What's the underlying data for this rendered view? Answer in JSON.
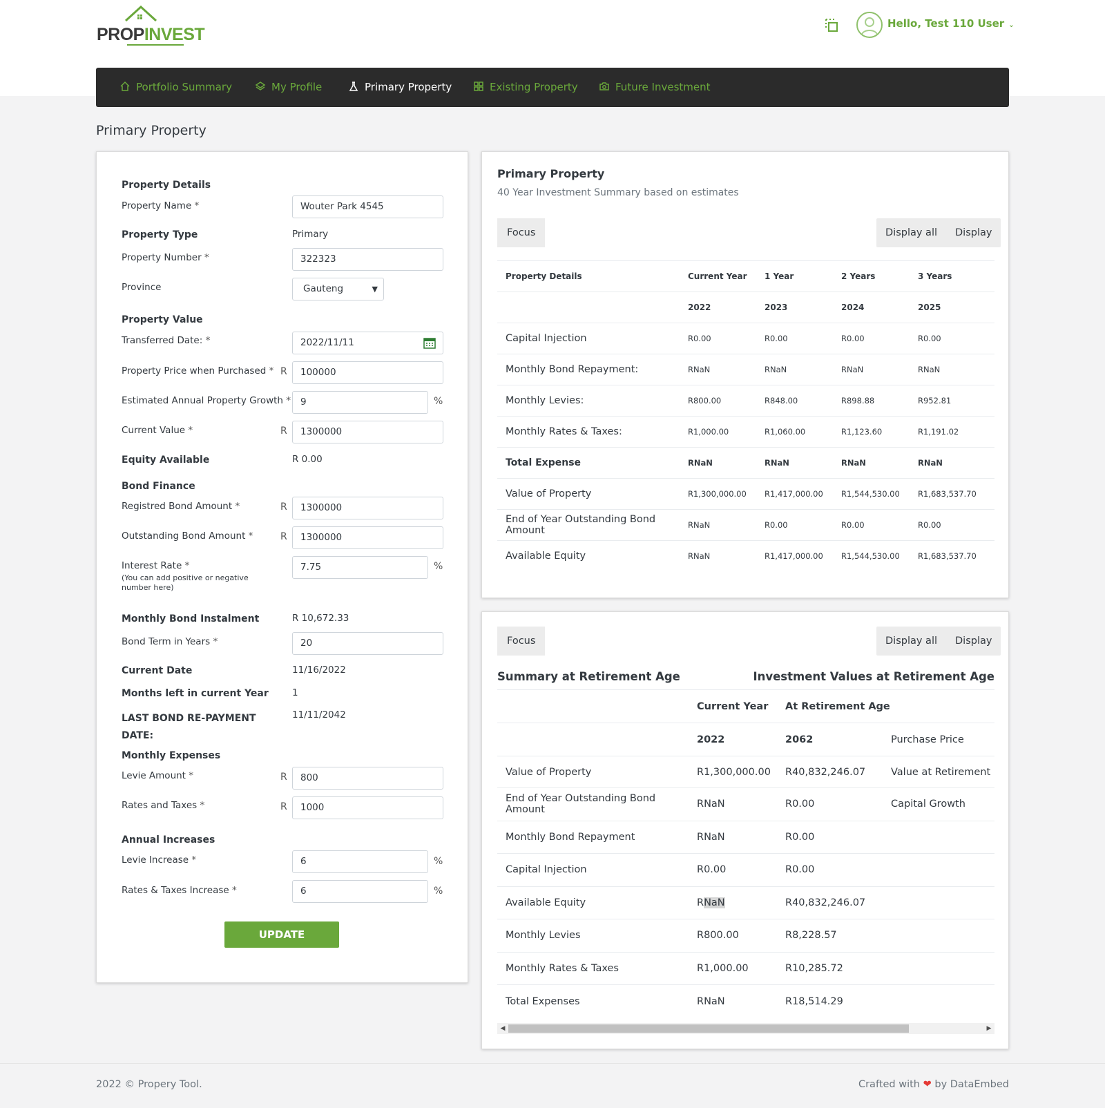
{
  "header": {
    "logo": {
      "part1": "PROP",
      "part2": "INVEST"
    },
    "greeting": "Hello, Test 110 User"
  },
  "nav": [
    {
      "label": "Portfolio Summary",
      "icon": "home-icon",
      "active": false
    },
    {
      "label": "My Profile",
      "icon": "layers-icon",
      "active": false
    },
    {
      "label": "Primary Property",
      "icon": "flask-icon",
      "active": true
    },
    {
      "label": "Existing Property",
      "icon": "grid-icon",
      "active": false
    },
    {
      "label": "Future Investment",
      "icon": "camera-icon",
      "active": false
    }
  ],
  "page_title": "Primary Property",
  "form": {
    "sec_details": "Property Details",
    "property_name_label": "Property Name",
    "property_name": "Wouter Park 4545",
    "property_type_label": "Property Type",
    "property_type": "Primary",
    "property_number_label": "Property Number",
    "property_number": "322323",
    "province_label": "Province",
    "province": "Gauteng",
    "sec_value": "Property Value",
    "transferred_date_label": "Transferred Date:",
    "transferred_date": "2022/11/11",
    "price_purchased_label": "Property Price when Purchased",
    "price_purchased": "100000",
    "growth_label": "Estimated Annual Property Growth",
    "growth": "9",
    "current_value_label": "Current Value",
    "current_value": "1300000",
    "equity_label": "Equity Available",
    "equity": "R 0.00",
    "sec_bond": "Bond Finance",
    "registered_bond_label": "Registred Bond Amount",
    "registered_bond": "1300000",
    "outstanding_bond_label": "Outstanding Bond Amount",
    "outstanding_bond": "1300000",
    "interest_rate_label": "Interest Rate",
    "interest_note": "(You can add positive or negative number here)",
    "interest_rate": "7.75",
    "instalment_label": "Monthly Bond Instalment",
    "instalment": "R 10,672.33",
    "bond_term_label": "Bond Term in Years",
    "bond_term": "20",
    "current_date_label": "Current Date",
    "current_date": "11/16/2022",
    "months_left_label": "Months left in current Year",
    "months_left": "1",
    "last_repayment_label": "LAST BOND RE-PAYMENT DATE:",
    "last_repayment": "11/11/2042",
    "sec_expenses": "Monthly Expenses",
    "levie_label": "Levie Amount",
    "levie": "800",
    "rates_label": "Rates and Taxes",
    "rates": "1000",
    "sec_increases": "Annual Increases",
    "levie_inc_label": "Levie Increase",
    "levie_inc": "6",
    "rates_inc_label": "Rates & Taxes Increase",
    "rates_inc": "6",
    "currency": "R",
    "percent": "%",
    "req": "*",
    "update_label": "UPDATE"
  },
  "summary": {
    "title": "Primary Property",
    "subtitle": "40 Year Investment Summary based on estimates",
    "focus": "Focus",
    "display_all": "Display all",
    "display": "Display",
    "headers": [
      "Property Details",
      "Current Year",
      "1 Year",
      "2 Years",
      "3 Years"
    ],
    "years": [
      "2022",
      "2023",
      "2024",
      "2025"
    ],
    "rows": [
      {
        "label": "Capital Injection",
        "values": [
          "R0.00",
          "R0.00",
          "R0.00",
          "R0.00"
        ],
        "bold": false
      },
      {
        "label": "Monthly Bond Repayment:",
        "values": [
          "RNaN",
          "RNaN",
          "RNaN",
          "RNaN"
        ],
        "bold": false
      },
      {
        "label": "Monthly Levies:",
        "values": [
          "R800.00",
          "R848.00",
          "R898.88",
          "R952.81"
        ],
        "bold": false
      },
      {
        "label": "Monthly Rates & Taxes:",
        "values": [
          "R1,000.00",
          "R1,060.00",
          "R1,123.60",
          "R1,191.02"
        ],
        "bold": false
      },
      {
        "label": "Total Expense",
        "values": [
          "RNaN",
          "RNaN",
          "RNaN",
          "RNaN"
        ],
        "bold": true
      },
      {
        "label": "Value of Property",
        "values": [
          "R1,300,000.00",
          "R1,417,000.00",
          "R1,544,530.00",
          "R1,683,537.70"
        ],
        "bold": false
      },
      {
        "label": "End of Year Outstanding Bond Amount",
        "values": [
          "RNaN",
          "R0.00",
          "R0.00",
          "R0.00"
        ],
        "bold": false
      },
      {
        "label": "Available Equity",
        "values": [
          "RNaN",
          "R1,417,000.00",
          "R1,544,530.00",
          "R1,683,537.70"
        ],
        "bold": false
      }
    ]
  },
  "retirement": {
    "focus": "Focus",
    "display_all": "Display all",
    "display": "Display",
    "left_title": "Summary at Retirement Age",
    "right_title": "Investment Values at Retirement Age",
    "col_current": "Current Year",
    "col_retire": "At Retirement Age",
    "year_current": "2022",
    "year_retire": "2062",
    "extra_header": "Purchase Price",
    "rows": [
      {
        "label": "Value of Property",
        "current": "R1,300,000.00",
        "retire": "R40,832,246.07",
        "extra": "Value at Retirement"
      },
      {
        "label": "End of Year Outstanding Bond Amount",
        "current": "RNaN",
        "retire": "R0.00",
        "extra": "Capital Growth"
      },
      {
        "label": "Monthly Bond Repayment",
        "current": "RNaN",
        "retire": "R0.00",
        "extra": ""
      },
      {
        "label": "Capital Injection",
        "current": "R0.00",
        "retire": "R0.00",
        "extra": ""
      },
      {
        "label": "Available Equity",
        "current": "RNaN",
        "retire": "R40,832,246.07",
        "extra": ""
      },
      {
        "label": "Monthly Levies",
        "current": "R800.00",
        "retire": "R8,228.57",
        "extra": ""
      },
      {
        "label": "Monthly Rates & Taxes",
        "current": "R1,000.00",
        "retire": "R10,285.72",
        "extra": ""
      },
      {
        "label": "Total Expenses",
        "current": "RNaN",
        "retire": "R18,514.29",
        "extra": ""
      }
    ]
  },
  "footer": {
    "left": "2022 © Propery Tool.",
    "right_pre": "Crafted with",
    "right_post": "by DataEmbed"
  },
  "colors": {
    "brand": "#6aa83b",
    "nav_bg": "#2b2b2b",
    "heart": "#e53935"
  }
}
